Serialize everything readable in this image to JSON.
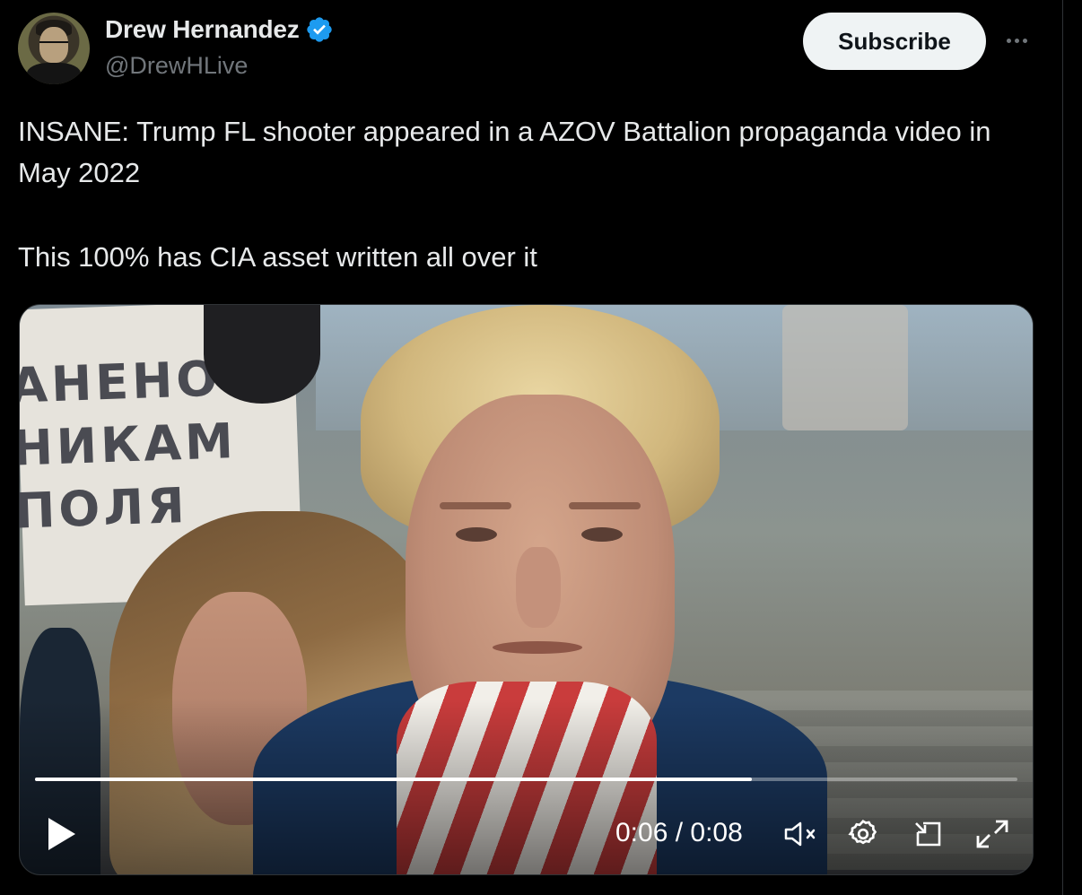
{
  "header": {
    "display_name": "Drew Hernandez",
    "handle": "@DrewHLive",
    "subscribe_label": "Subscribe"
  },
  "tweet": {
    "line1": "INSANE: Trump FL shooter appeared in a AZOV Battalion propaganda video in May 2022",
    "line2": "This 100% has CIA asset written all over it"
  },
  "media": {
    "sign_lines": [
      "АНЕНО",
      "НИКАМ",
      "ПОЛЯ"
    ],
    "time_display": "0:06 / 0:08",
    "progress": 0.73
  },
  "colors": {
    "background": "#000000",
    "text_primary": "#e7e9ea",
    "text_secondary": "#71767b",
    "verified_blue": "#1d9bf0",
    "subscribe_bg": "#eff3f4"
  },
  "icons": [
    "verified-badge-icon",
    "more-icon",
    "play-icon",
    "mute-icon",
    "settings-icon",
    "pip-icon",
    "fullscreen-icon"
  ]
}
